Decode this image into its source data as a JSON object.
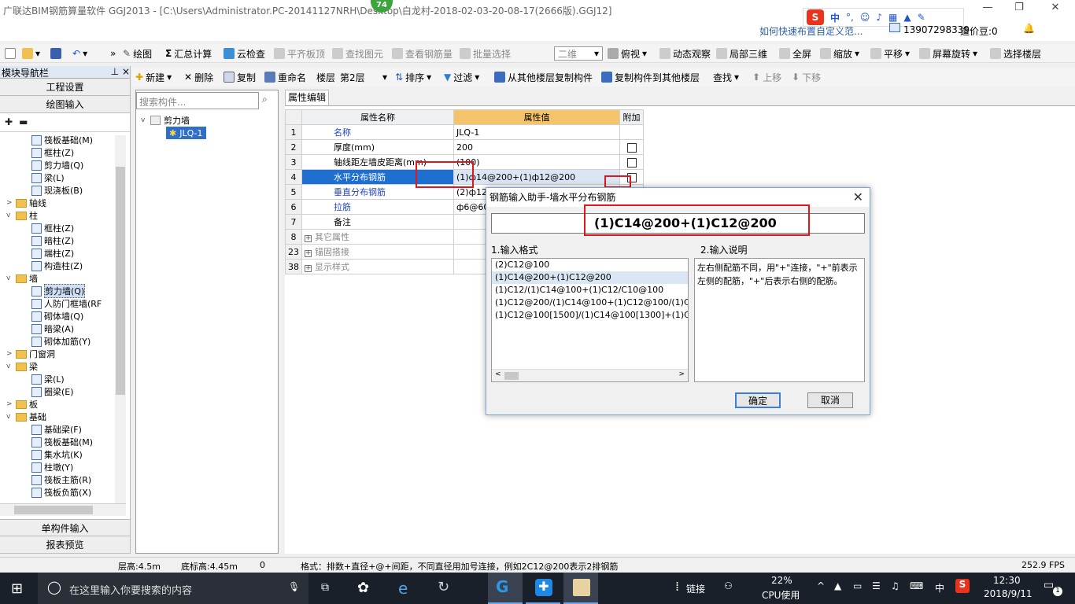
{
  "window": {
    "title": "广联达BIM钢筋算量软件 GGJ2013 - [C:\\Users\\Administrator.PC-20141127NRH\\Desktop\\白龙村-2018-02-03-20-08-17(2666版).GGJ12]",
    "badge": "74",
    "help_link": "如何快速布置自定义范...",
    "phone": "13907298339",
    "coins": "造价豆:0"
  },
  "toolbar1": [
    {
      "label": "绘图"
    },
    {
      "label": "汇总计算"
    },
    {
      "label": "云检查"
    },
    {
      "label": "平齐板顶"
    },
    {
      "label": "查找图元"
    },
    {
      "label": "查看钢筋量"
    },
    {
      "label": "批量选择"
    },
    {
      "label": "二维"
    },
    {
      "label": "俯视"
    },
    {
      "label": "动态观察"
    },
    {
      "label": "局部三维"
    },
    {
      "label": "全屏"
    },
    {
      "label": "缩放"
    },
    {
      "label": "平移"
    },
    {
      "label": "屏幕旋转"
    },
    {
      "label": "选择楼层"
    }
  ],
  "toolbar2": [
    {
      "label": "新建"
    },
    {
      "label": "删除"
    },
    {
      "label": "复制"
    },
    {
      "label": "重命名"
    },
    {
      "label": "楼层"
    },
    {
      "label": "第2层"
    },
    {
      "label": "排序"
    },
    {
      "label": "过滤"
    },
    {
      "label": "从其他楼层复制构件"
    },
    {
      "label": "复制构件到其他楼层"
    },
    {
      "label": "查找"
    },
    {
      "label": "上移"
    },
    {
      "label": "下移"
    }
  ],
  "left_panel": {
    "title": "模块导航栏",
    "btn_project": "工程设置",
    "btn_draw": "绘图输入",
    "btn_single": "单构件输入",
    "btn_report": "报表预览",
    "tree": [
      {
        "label": "筏板基础(M)",
        "level": 2
      },
      {
        "label": "框柱(Z)",
        "level": 2
      },
      {
        "label": "剪力墙(Q)",
        "level": 2
      },
      {
        "label": "梁(L)",
        "level": 2
      },
      {
        "label": "现浇板(B)",
        "level": 2
      },
      {
        "label": "轴线",
        "level": 1,
        "toggle": ">"
      },
      {
        "label": "柱",
        "level": 1,
        "toggle": "v"
      },
      {
        "label": "框柱(Z)",
        "level": 2
      },
      {
        "label": "暗柱(Z)",
        "level": 2
      },
      {
        "label": "端柱(Z)",
        "level": 2
      },
      {
        "label": "构造柱(Z)",
        "level": 2
      },
      {
        "label": "墙",
        "level": 1,
        "toggle": "v"
      },
      {
        "label": "剪力墙(Q)",
        "level": 2,
        "selected": true
      },
      {
        "label": "人防门框墙(RF",
        "level": 2
      },
      {
        "label": "砌体墙(Q)",
        "level": 2
      },
      {
        "label": "暗梁(A)",
        "level": 2
      },
      {
        "label": "砌体加筋(Y)",
        "level": 2
      },
      {
        "label": "门窗洞",
        "level": 1,
        "toggle": ">"
      },
      {
        "label": "梁",
        "level": 1,
        "toggle": "v"
      },
      {
        "label": "梁(L)",
        "level": 2
      },
      {
        "label": "圈梁(E)",
        "level": 2
      },
      {
        "label": "板",
        "level": 1,
        "toggle": ">"
      },
      {
        "label": "基础",
        "level": 1,
        "toggle": "v"
      },
      {
        "label": "基础梁(F)",
        "level": 2
      },
      {
        "label": "筏板基础(M)",
        "level": 2
      },
      {
        "label": "集水坑(K)",
        "level": 2
      },
      {
        "label": "柱墩(Y)",
        "level": 2
      },
      {
        "label": "筏板主筋(R)",
        "level": 2
      },
      {
        "label": "筏板负筋(X)",
        "level": 2
      }
    ]
  },
  "mid_panel": {
    "search_placeholder": "搜索构件...",
    "root": "剪力墙",
    "child": "JLQ-1"
  },
  "prop": {
    "tab": "属性编辑",
    "col_name": "属性名称",
    "col_value": "属性值",
    "col_add": "附加",
    "rows": [
      {
        "num": "1",
        "name": "名称",
        "value": "JLQ-1",
        "blue": true,
        "cb": false
      },
      {
        "num": "2",
        "name": "厚度(mm)",
        "value": "200",
        "blue": false,
        "cb": true
      },
      {
        "num": "3",
        "name": "轴线距左墙皮距离(mm)",
        "value": "(100)",
        "blue": false,
        "cb": true
      },
      {
        "num": "4",
        "name": "水平分布钢筋",
        "value": "(1)ф14@200+(1)ф12@200",
        "blue": true,
        "cb": true,
        "selected": true
      },
      {
        "num": "5",
        "name": "垂直分布钢筋",
        "value": "(2)ф12",
        "blue": true,
        "cb": false
      },
      {
        "num": "6",
        "name": "拉筋",
        "value": "ф6@600",
        "blue": true,
        "cb": false
      },
      {
        "num": "7",
        "name": "备注",
        "value": "",
        "blue": false,
        "cb": false
      },
      {
        "num": "8",
        "name": "其它属性",
        "value": "",
        "blue": false,
        "cb": false,
        "group": true
      },
      {
        "num": "23",
        "name": "锚固搭接",
        "value": "",
        "blue": false,
        "cb": false,
        "group": true
      },
      {
        "num": "38",
        "name": "显示样式",
        "value": "",
        "blue": false,
        "cb": false,
        "group": true
      }
    ]
  },
  "dialog": {
    "title": "钢筋输入助手-墙水平分布钢筋",
    "input_value": "(1)C14@200+(1)C12@200",
    "format_label": "1.输入格式",
    "desc_label": "2.输入说明",
    "formats": [
      "(2)C12@100",
      "(1)C14@200+(1)C12@200",
      "(1)C12/(1)C14@100+(1)C12/C10@100",
      "(1)C12@200/(1)C14@100+(1)C12@100/(1)C10@",
      "(1)C12@100[1500]/(1)C14@100[1300]+(1)C12@"
    ],
    "description": "左右侧配筋不同，用\"+\"连接，\"+\"前表示左侧的配筋，\"+\"后表示右侧的配筋。",
    "ok": "确定",
    "cancel": "取消"
  },
  "statusbar": {
    "floor_height": "层高:4.5m",
    "base_height": "底标高:4.45m",
    "zero": "0",
    "hint": "格式：排数+直径+@+间距，不同直径用加号连接，例如2C12@200表示2排钢筋",
    "fps": "252.9 FPS"
  },
  "taskbar": {
    "search_placeholder": "在这里输入你要搜索的内容",
    "link": "链接",
    "cpu_pct": "22%",
    "cpu_label": "CPU使用",
    "ime": "中",
    "time": "12:30",
    "date": "2018/9/11",
    "notif": "1"
  }
}
